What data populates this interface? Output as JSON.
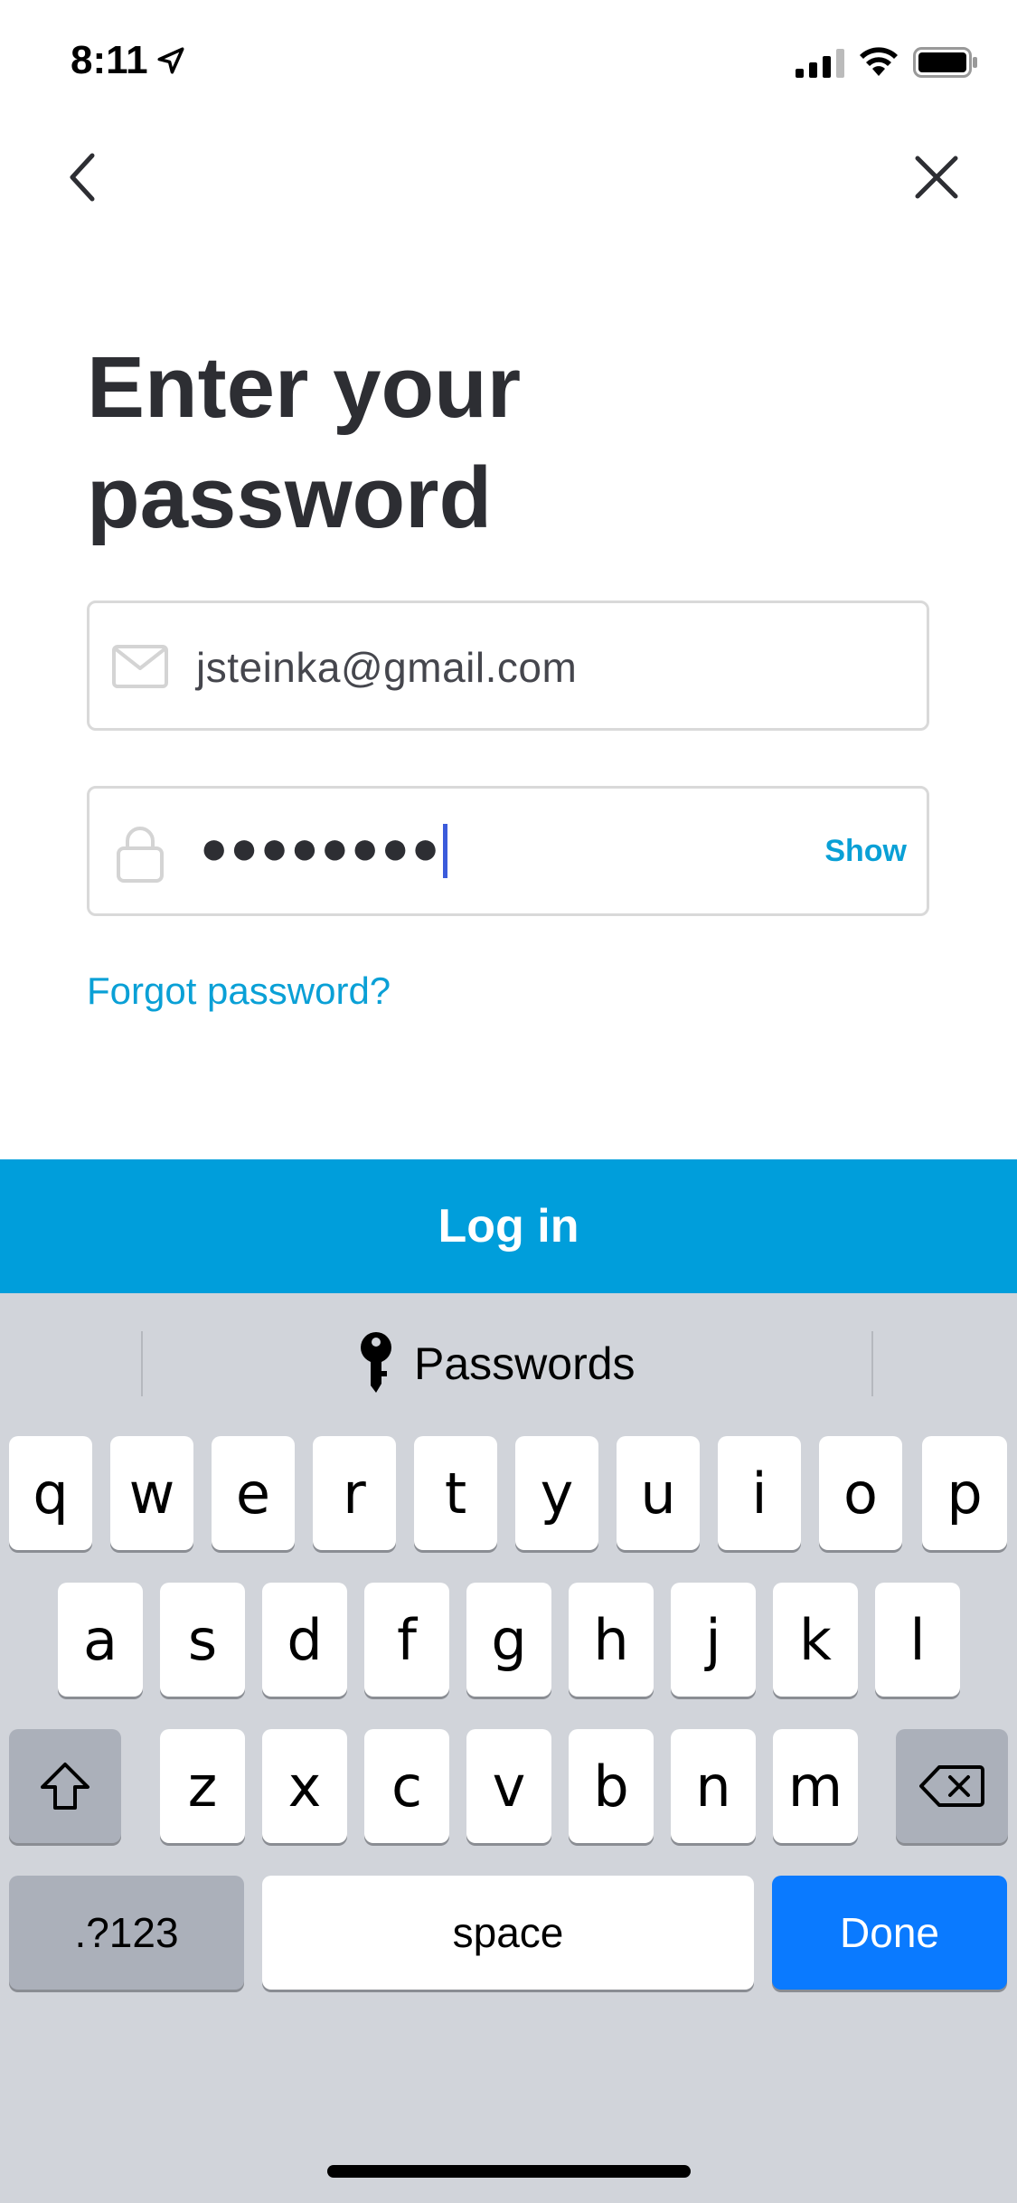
{
  "status_bar": {
    "time": "8:11"
  },
  "nav": {
    "back_icon": "chevron-left-icon",
    "close_icon": "close-icon"
  },
  "page": {
    "title": "Enter your password"
  },
  "email_field": {
    "value": "jsteinka@gmail.com",
    "icon": "envelope-icon"
  },
  "password_field": {
    "masked_value": "●●●●●●●●",
    "icon": "lock-icon",
    "show_label": "Show"
  },
  "forgot_link": "Forgot password?",
  "login_button": "Log in",
  "colors": {
    "accent": "#009edb",
    "link": "#0aa0d6",
    "keyboard_bg": "#d1d4da",
    "done_key": "#0a7aff"
  },
  "keyboard": {
    "suggestion": "Passwords",
    "row1": [
      "q",
      "w",
      "e",
      "r",
      "t",
      "y",
      "u",
      "i",
      "o",
      "p"
    ],
    "row2": [
      "a",
      "s",
      "d",
      "f",
      "g",
      "h",
      "j",
      "k",
      "l"
    ],
    "row3": [
      "z",
      "x",
      "c",
      "v",
      "b",
      "n",
      "m"
    ],
    "numbers_key": ".?123",
    "space_key": "space",
    "done_key": "Done"
  }
}
